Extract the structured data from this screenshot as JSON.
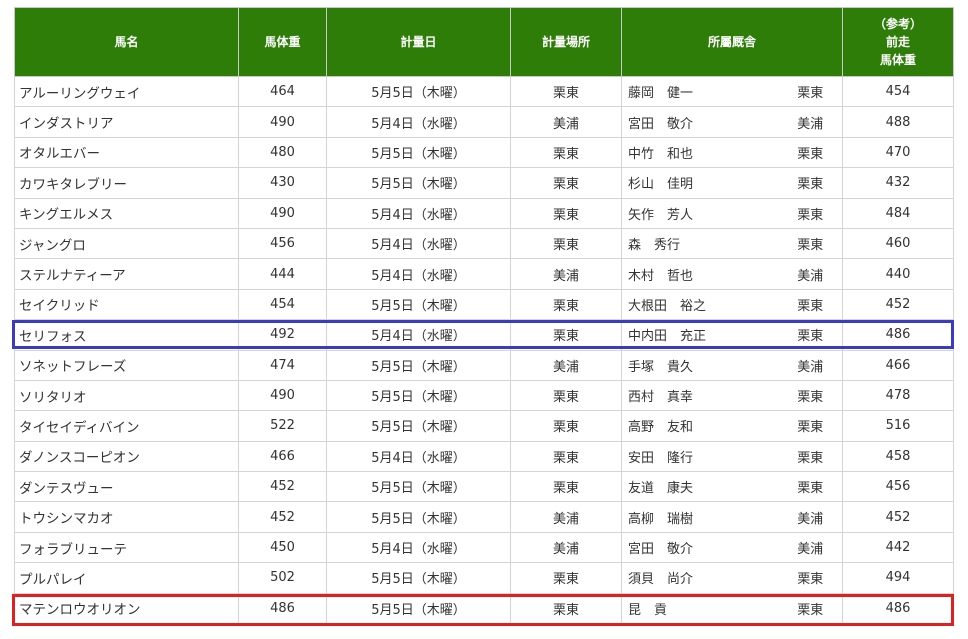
{
  "headers": {
    "name": "馬名",
    "weight": "馬体重",
    "date": "計量日",
    "place": "計量場所",
    "stable": "所屬厩舎",
    "prev_line1": "（参考）",
    "prev_line2": "前走",
    "prev_line3": "馬体重"
  },
  "highlight_colors": {
    "blue": "#3b3bbf",
    "red": "#e02020"
  },
  "rows": [
    {
      "name": "アルーリングウェイ",
      "weight": "464",
      "date": "5月5日（木曜）",
      "place": "栗東",
      "trainer": "藤岡　健一",
      "loc": "栗東",
      "prev": "454"
    },
    {
      "name": "インダストリア",
      "weight": "490",
      "date": "5月4日（水曜）",
      "place": "美浦",
      "trainer": "宮田　敬介",
      "loc": "美浦",
      "prev": "488"
    },
    {
      "name": "オタルエバー",
      "weight": "480",
      "date": "5月5日（木曜）",
      "place": "栗東",
      "trainer": "中竹　和也",
      "loc": "栗東",
      "prev": "470"
    },
    {
      "name": "カワキタレブリー",
      "weight": "430",
      "date": "5月5日（木曜）",
      "place": "栗東",
      "trainer": "杉山　佳明",
      "loc": "栗東",
      "prev": "432"
    },
    {
      "name": "キングエルメス",
      "weight": "490",
      "date": "5月4日（水曜）",
      "place": "栗東",
      "trainer": "矢作　芳人",
      "loc": "栗東",
      "prev": "484"
    },
    {
      "name": "ジャングロ",
      "weight": "456",
      "date": "5月4日（水曜）",
      "place": "栗東",
      "trainer": "森　秀行",
      "loc": "栗東",
      "prev": "460"
    },
    {
      "name": "ステルナティーア",
      "weight": "444",
      "date": "5月4日（水曜）",
      "place": "美浦",
      "trainer": "木村　哲也",
      "loc": "美浦",
      "prev": "440"
    },
    {
      "name": "セイクリッド",
      "weight": "454",
      "date": "5月5日（木曜）",
      "place": "栗東",
      "trainer": "大根田　裕之",
      "loc": "栗東",
      "prev": "452"
    },
    {
      "name": "セリフォス",
      "weight": "492",
      "date": "5月4日（水曜）",
      "place": "栗東",
      "trainer": "中内田　充正",
      "loc": "栗東",
      "prev": "486"
    },
    {
      "name": "ソネットフレーズ",
      "weight": "474",
      "date": "5月5日（木曜）",
      "place": "美浦",
      "trainer": "手塚　貴久",
      "loc": "美浦",
      "prev": "466"
    },
    {
      "name": "ソリタリオ",
      "weight": "490",
      "date": "5月5日（木曜）",
      "place": "栗東",
      "trainer": "西村　真幸",
      "loc": "栗東",
      "prev": "478"
    },
    {
      "name": "タイセイディバイン",
      "weight": "522",
      "date": "5月5日（木曜）",
      "place": "栗東",
      "trainer": "高野　友和",
      "loc": "栗東",
      "prev": "516"
    },
    {
      "name": "ダノンスコーピオン",
      "weight": "466",
      "date": "5月4日（水曜）",
      "place": "栗東",
      "trainer": "安田　隆行",
      "loc": "栗東",
      "prev": "458"
    },
    {
      "name": "ダンテスヴュー",
      "weight": "452",
      "date": "5月5日（木曜）",
      "place": "栗東",
      "trainer": "友道　康夫",
      "loc": "栗東",
      "prev": "456"
    },
    {
      "name": "トウシンマカオ",
      "weight": "452",
      "date": "5月5日（木曜）",
      "place": "美浦",
      "trainer": "高柳　瑞樹",
      "loc": "美浦",
      "prev": "452"
    },
    {
      "name": "フォラブリューテ",
      "weight": "450",
      "date": "5月4日（水曜）",
      "place": "美浦",
      "trainer": "宮田　敬介",
      "loc": "美浦",
      "prev": "442"
    },
    {
      "name": "プルパレイ",
      "weight": "502",
      "date": "5月5日（木曜）",
      "place": "栗東",
      "trainer": "須貝　尚介",
      "loc": "栗東",
      "prev": "494"
    },
    {
      "name": "マテンロウオリオン",
      "weight": "486",
      "date": "5月5日（木曜）",
      "place": "栗東",
      "trainer": "昆　貢",
      "loc": "栗東",
      "prev": "486"
    }
  ]
}
